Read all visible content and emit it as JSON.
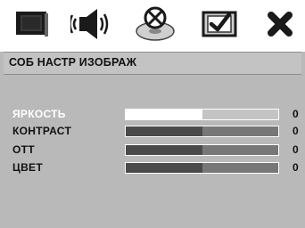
{
  "tabs": [
    {
      "icon": "picture-screen-icon"
    },
    {
      "icon": "audio-speaker-icon"
    },
    {
      "icon": "disc-icon"
    },
    {
      "icon": "preferences-check-icon"
    },
    {
      "icon": "close-x-icon"
    }
  ],
  "active_tab_index": 0,
  "panel": {
    "title": "СОБ НАСТР ИЗОБРАЖ",
    "settings": [
      {
        "label": "ЯРКОСТЬ",
        "value": "0",
        "level": 0.5,
        "selected": true
      },
      {
        "label": "КОНТРАСТ",
        "value": "0",
        "level": 0.5,
        "selected": false
      },
      {
        "label": "ОТТ",
        "value": "0",
        "level": 0.5,
        "selected": false
      },
      {
        "label": "ЦВЕТ",
        "value": "0",
        "level": 0.5,
        "selected": false
      }
    ]
  },
  "colors": {
    "panel_bg": "#b9b9b9",
    "bar_dark": "#4a4a4a",
    "highlight": "#ffffff"
  }
}
